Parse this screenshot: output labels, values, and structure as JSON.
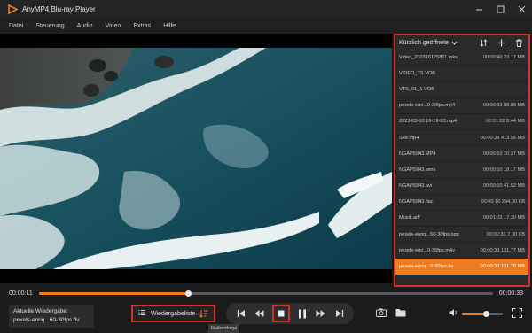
{
  "app": {
    "title": "AnyMP4 Blu-ray Player",
    "accent": "#f07c22",
    "highlight": "#d4312a"
  },
  "menu": [
    "Datei",
    "Steuerung",
    "Audio",
    "Video",
    "Extras",
    "Hilfe"
  ],
  "playlist": {
    "header": "Kürzlich geöffnete",
    "items": [
      {
        "name": "Video_230316175811.mkv",
        "meta": "00:00:40 23.17 MB"
      },
      {
        "name": "VIDEO_TS.VOB",
        "meta": ""
      },
      {
        "name": "VTS_01_1.VOB",
        "meta": ""
      },
      {
        "name": "pexels-enri...0-30fps.mp4",
        "meta": "00:00:33 98.08 MB"
      },
      {
        "name": "2023-05-10 16-19-03.mp4",
        "meta": "00:01:02 8.44 MB"
      },
      {
        "name": "See.mp4",
        "meta": "00:00:33 413.56 MB"
      },
      {
        "name": "NGAP5943.MP4",
        "meta": "00:00:10 20.37 MB"
      },
      {
        "name": "NGAP5943.wmv",
        "meta": "00:00:10 18.17 MB"
      },
      {
        "name": "NGAP5943.avi",
        "meta": "00:00:10 41.52 MB"
      },
      {
        "name": "NGAP5943.flac",
        "meta": "00:00:10 294.00 KB"
      },
      {
        "name": "Musik.aiff",
        "meta": "00:01:03 17.30 MB"
      },
      {
        "name": "pexels-enriq...60-30fps.ogg",
        "meta": "00:00:33 7.00 KB"
      },
      {
        "name": "pexels-enri...0-30fps.m4v",
        "meta": "00:00:33 131.77 MB"
      },
      {
        "name": "pexels-enriq...0-30fps.flv",
        "meta": "00:00:33 131.78 MB"
      }
    ],
    "active_index": 13
  },
  "playback": {
    "current_time": "00:00:11",
    "total_time": "00:00:33",
    "progress": 0.33,
    "now_playing_label": "Aktuelle Wiedergabe:",
    "now_playing_file": "pexels-enriq...60-30fps.flv",
    "playlist_button": "Wiedergabeliste",
    "tooltip": "Reihenfolge",
    "volume": 0.6
  },
  "icons": [
    "app-logo-icon",
    "minimize-icon",
    "maximize-icon",
    "close-icon",
    "chevron-down-icon",
    "sort-icon",
    "add-icon",
    "trash-icon",
    "list-icon",
    "order-icon",
    "skip-back-icon",
    "rewind-icon",
    "stop-icon",
    "pause-icon",
    "fast-forward-icon",
    "skip-forward-icon",
    "camera-icon",
    "folder-icon",
    "volume-icon",
    "fullscreen-icon"
  ]
}
